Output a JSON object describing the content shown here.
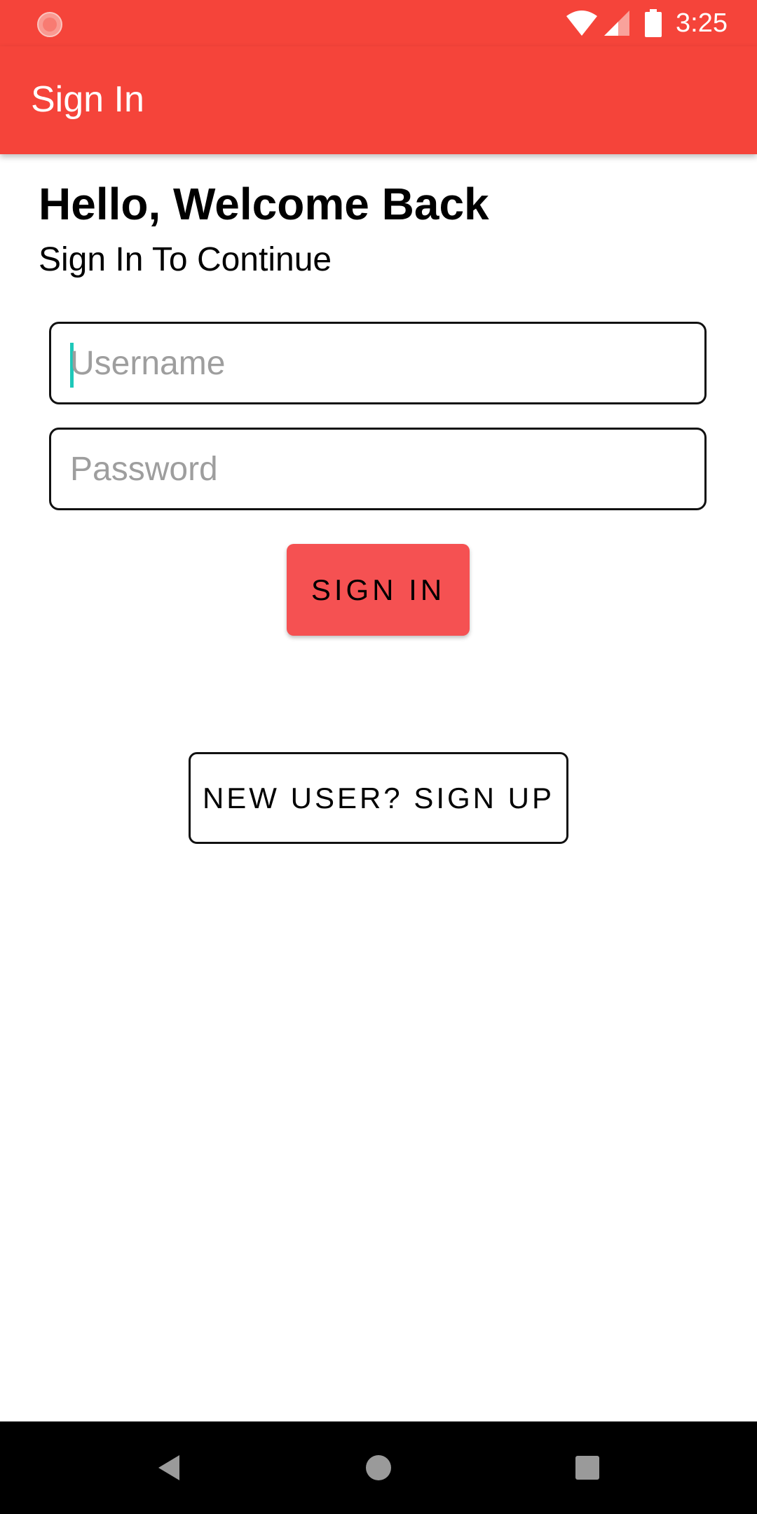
{
  "status_bar": {
    "time": "3:25",
    "icons": [
      "app-notification-icon",
      "wifi-icon",
      "cell-signal-icon",
      "battery-icon"
    ]
  },
  "toolbar": {
    "title": "Sign In"
  },
  "main": {
    "heading": "Hello, Welcome Back",
    "subheading": "Sign In To Continue",
    "username": {
      "placeholder": "Username",
      "value": ""
    },
    "password": {
      "placeholder": "Password",
      "value": ""
    },
    "signin_button": "SIGN IN",
    "signup_button": "NEW USER? SIGN UP"
  },
  "navigation_bar": {
    "icons": [
      "back-icon",
      "home-icon",
      "recents-icon"
    ]
  },
  "colors": {
    "primary": "#f5443a",
    "button": "#f55152",
    "cursor": "#1ec8b9"
  }
}
